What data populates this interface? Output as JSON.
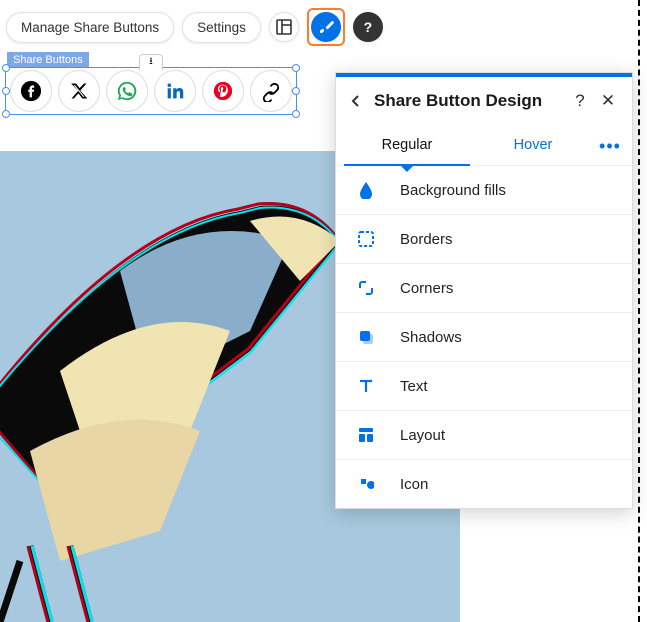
{
  "toolbar": {
    "manage_label": "Manage Share Buttons",
    "settings_label": "Settings"
  },
  "selection": {
    "label": "Share Buttons"
  },
  "share_icons": [
    "facebook",
    "x-twitter",
    "whatsapp",
    "linkedin",
    "pinterest",
    "link"
  ],
  "panel": {
    "title": "Share Button Design",
    "tabs": {
      "regular": "Regular",
      "hover": "Hover"
    },
    "sections": {
      "background": "Background fills",
      "borders": "Borders",
      "corners": "Corners",
      "shadows": "Shadows",
      "text": "Text",
      "layout": "Layout",
      "icon": "Icon"
    }
  },
  "colors": {
    "accent": "#0071e6",
    "highlight": "#ff7a2b"
  }
}
